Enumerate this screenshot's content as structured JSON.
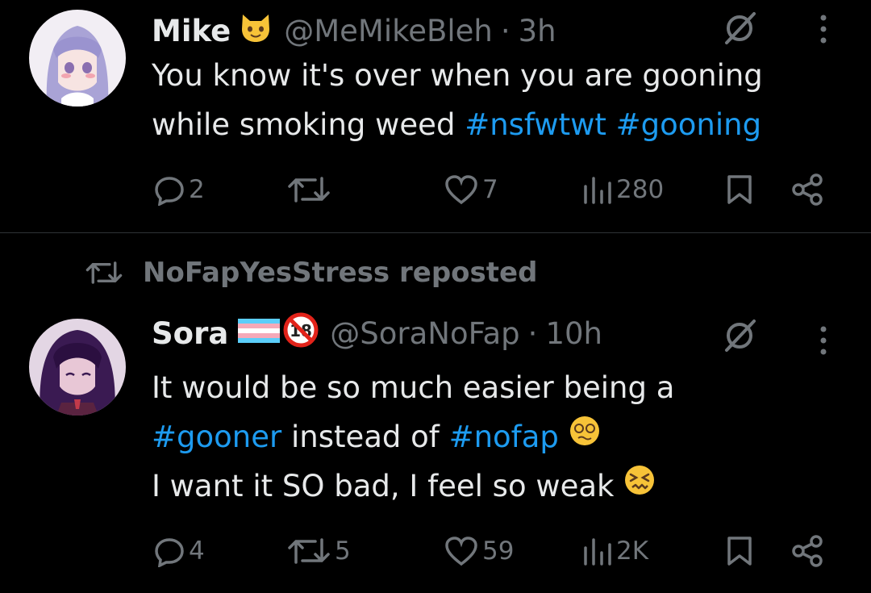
{
  "tweets": [
    {
      "author_name": "Mike",
      "author_emoji": "cat-face-emoji",
      "handle": "@MeMikeBleh",
      "separator": "·",
      "time": "3h",
      "lines": [
        {
          "text": "You know it's over when you are gooning",
          "tags": []
        },
        {
          "text": "while smoking weed ",
          "tags": [
            "#nsfwtwt",
            "#gooning"
          ]
        }
      ],
      "actions": {
        "replies": "2",
        "reposts": "",
        "likes": "7",
        "views": "280"
      }
    },
    {
      "repost_banner": "NoFapYesStress reposted",
      "author_name": "Sora",
      "author_badges": [
        "trans-flag-emoji",
        "no-under-18-emoji"
      ],
      "handle": "@SoraNoFap",
      "separator": "·",
      "time": "10h",
      "line1": "It would be so much easier being a",
      "line2_tag1": "#gooner",
      "line2_mid": " instead of ",
      "line2_tag2": "#nofap",
      "line3": "I want it SO bad, I feel so weak",
      "actions": {
        "replies": "4",
        "reposts": "5",
        "likes": "59",
        "views": "2K"
      }
    }
  ],
  "colors": {
    "background": "#000000",
    "text": "#e7e9ea",
    "secondary": "#71767b",
    "link": "#1d9bf0",
    "divider": "#2f3336"
  }
}
